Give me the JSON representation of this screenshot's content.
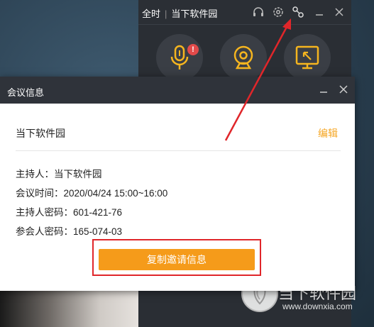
{
  "app": {
    "toolbar_title": "全时",
    "toolbar_subtitle": "当下软件园"
  },
  "toolbar_icons": [
    "headset-icon",
    "settings-icon",
    "link-icon",
    "minimize-icon",
    "close-icon"
  ],
  "tools": [
    {
      "name": "microphone",
      "badge": "!"
    },
    {
      "name": "camera"
    },
    {
      "name": "screen-share"
    }
  ],
  "dialog": {
    "title": "会议信息",
    "meeting_name": "当下软件园",
    "edit_label": "编辑",
    "rows": [
      "主持人：当下软件园",
      "会议时间：2020/04/24 15:00~16:00",
      "主持人密码：601-421-76",
      "参会人密码：165-074-03"
    ],
    "copy_button_label": "复制邀请信息"
  },
  "watermark": {
    "name": "当下软件园",
    "url": "www.downxia.com"
  },
  "colors": {
    "accent_orange": "#f59b1a",
    "highlight_red": "#e0262a",
    "titlebar_dark": "#2f333a",
    "icon_yellow": "#f5b51f"
  }
}
